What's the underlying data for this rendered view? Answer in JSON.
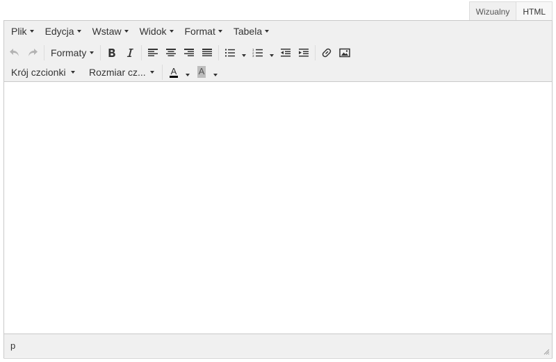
{
  "mode_tabs": [
    "Wizualny",
    "HTML"
  ],
  "menubar": {
    "items": [
      "Plik",
      "Edycja",
      "Wstaw",
      "Widok",
      "Format",
      "Tabela"
    ]
  },
  "toolbar": {
    "formats_label": "Formaty",
    "font_family_label": "Krój czcionki",
    "font_size_label": "Rozmiar cz...",
    "text_color_letter": "A",
    "bg_color_letter": "A"
  },
  "statusbar": {
    "path": "p"
  },
  "colors": {
    "toolbar_bg": "#f0f0f0",
    "border": "#c9c9c9"
  }
}
